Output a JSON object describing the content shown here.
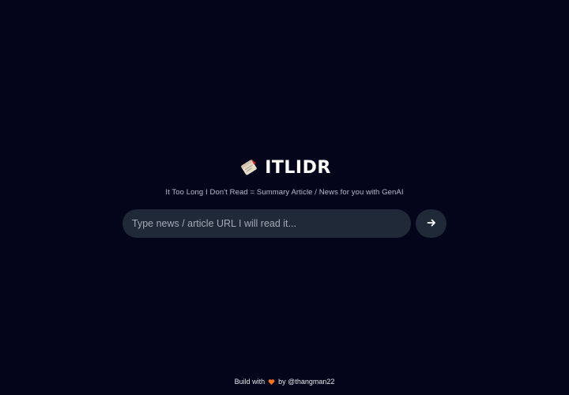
{
  "app": {
    "title": "ITLIDR",
    "tagline": "It Too Long I Don't Read = Summary Article / News for you with GenAI",
    "logo_icon": "newspaper-roll-icon"
  },
  "search": {
    "placeholder": "Type news / article URL I will read it...",
    "value": "",
    "submit_icon": "arrow-right-icon"
  },
  "footer": {
    "prefix": "Build with",
    "heart_icon": "orange-heart-icon",
    "suffix": "by @thangman22"
  },
  "colors": {
    "background": "#03061a",
    "input_background": "#1f2937",
    "heart": "#f97316"
  }
}
